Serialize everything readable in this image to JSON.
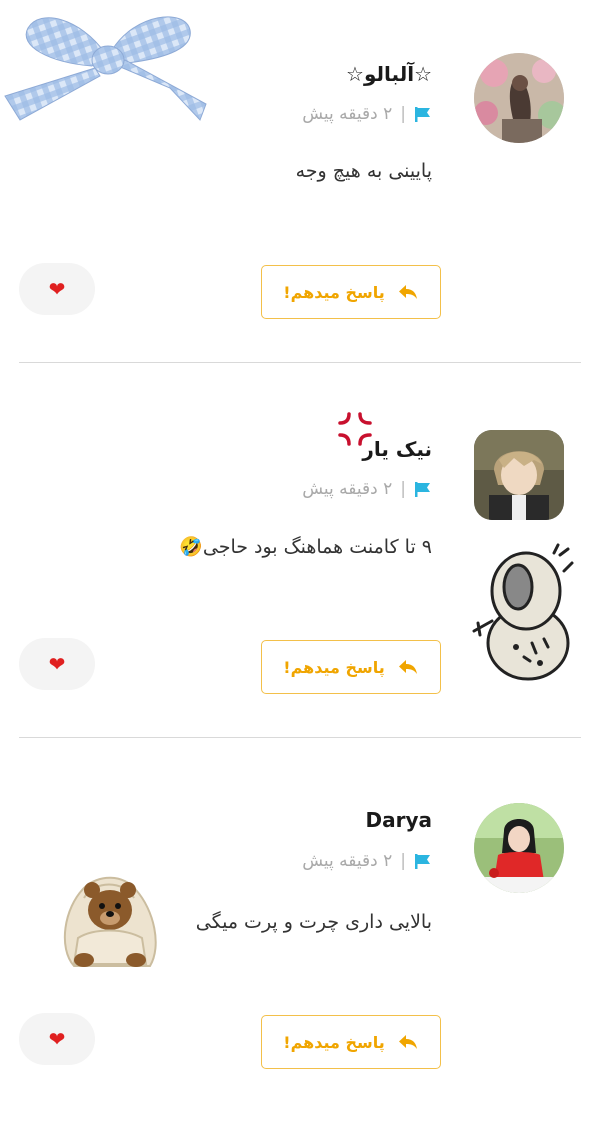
{
  "comments": [
    {
      "username": "☆آلبالو☆",
      "time": "۲ دقیقه پیش",
      "text": "پایینی به هیچ وجه",
      "reply_label": "پاسخ میدهم!",
      "like_icon": "heart-icon"
    },
    {
      "username": "نیک یار",
      "time": "۲ دقیقه پیش",
      "text": "۹ تا کامنت هماهنگ بود حاجی🤣",
      "reply_label": "پاسخ میدهم!",
      "like_icon": "heart-icon"
    },
    {
      "username": "Darya",
      "time": "۲ دقیقه پیش",
      "text": "بالایی داری چرت و پرت میگی",
      "reply_label": "پاسخ میدهم!",
      "like_icon": "heart-icon"
    }
  ],
  "meta_separator": "|",
  "colors": {
    "accent": "#f0a500",
    "flag": "#2bb5e0",
    "like_bg": "#f4f4f4",
    "heart": "#e02020",
    "divider": "#d9d9d9"
  }
}
